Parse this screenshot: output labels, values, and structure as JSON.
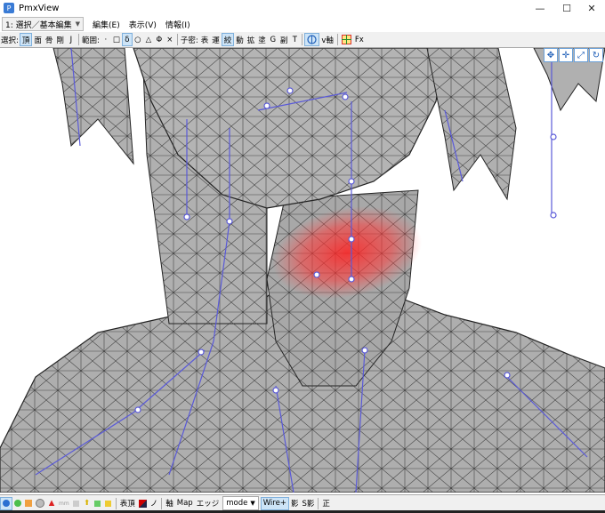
{
  "window": {
    "title": "PmxView",
    "minimize": "—",
    "maximize": "☐",
    "close": "✕"
  },
  "menubar": {
    "mode_select": "1: 選択／基本編集",
    "items": [
      "編集(E)",
      "表示(V)",
      "情報(I)"
    ]
  },
  "toolbar": {
    "select_label": "選択:",
    "select_items": [
      "頂",
      "面",
      "骨",
      "剛",
      "J"
    ],
    "range_label": "範囲:",
    "range_items": [
      "·",
      "□",
      "δ",
      "○",
      "△",
      "Φ",
      "×"
    ],
    "cross_label": "子密:",
    "cross_items": [
      "表",
      "運",
      "絞",
      "動",
      "拡",
      "塗",
      "G",
      "副",
      "T"
    ],
    "vaxis_label": "v軸",
    "fx_label": "Fx"
  },
  "bottombar": {
    "surface_label": "表頂",
    "no_label": "ノ",
    "axis_label": "軸",
    "map_label": "Map",
    "edge_label": "エッジ",
    "mode_dropdown": "mode",
    "wire_dropdown": "Wire+",
    "shadow_label": "影",
    "sshadow_label": "S影",
    "front_label": "正"
  },
  "colors": {
    "mesh_fill": "#aeaeae",
    "wire": "#3a3a3a",
    "bone": "#5a5ad8",
    "weight": "#ff2828",
    "toolbar_bg": "#f0f0f0",
    "active_bg": "#cde4f7"
  }
}
